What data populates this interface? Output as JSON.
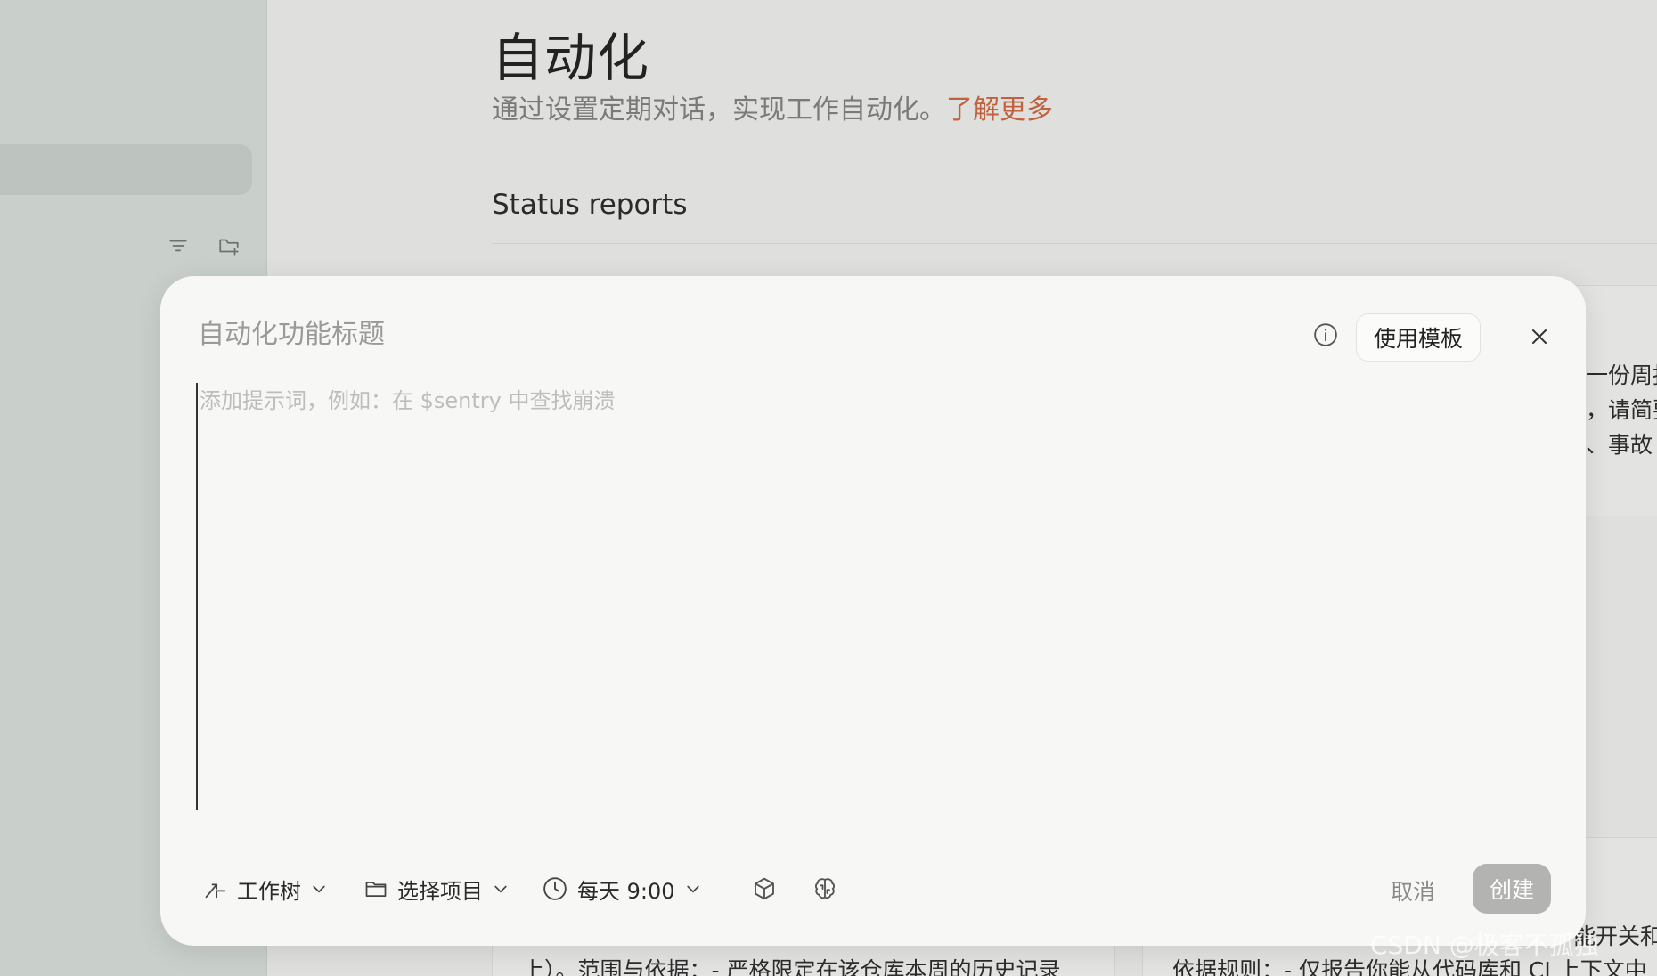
{
  "page": {
    "title": "自动化",
    "subtitle": "通过设置定期对话，实现工作自动化。",
    "learn_more": "了解更多",
    "section_title": "Status reports"
  },
  "background_snippets": {
    "right_card_lines": [
      "一份周报",
      "，请简要",
      "、事故"
    ],
    "bottom_left": "上）。范围与依据：- 严格限定在该仓库本周的历史记录",
    "bottom_right_top": "能开关和",
    "bottom_right": "依据规则：- 仅报告你能从代码库和 CI 上下文中"
  },
  "sidebar": {
    "filter_icon": "filter-icon",
    "new_folder_icon": "folder-plus-icon"
  },
  "modal": {
    "title_placeholder": "自动化功能标题",
    "template_button": "使用模板",
    "prompt_placeholder": "添加提示词，例如：在 $sentry 中查找崩溃",
    "worktree": "工作树",
    "project": "选择项目",
    "schedule": "每天 9:00",
    "cancel": "取消",
    "create": "创建"
  },
  "watermark": "CSDN @极客不孤独",
  "colors": {
    "accent_link": "#c0623e",
    "create_disabled": "#b3b3b1",
    "sidebar_bg": "#c9cfcb",
    "modal_bg": "#f7f7f5"
  }
}
